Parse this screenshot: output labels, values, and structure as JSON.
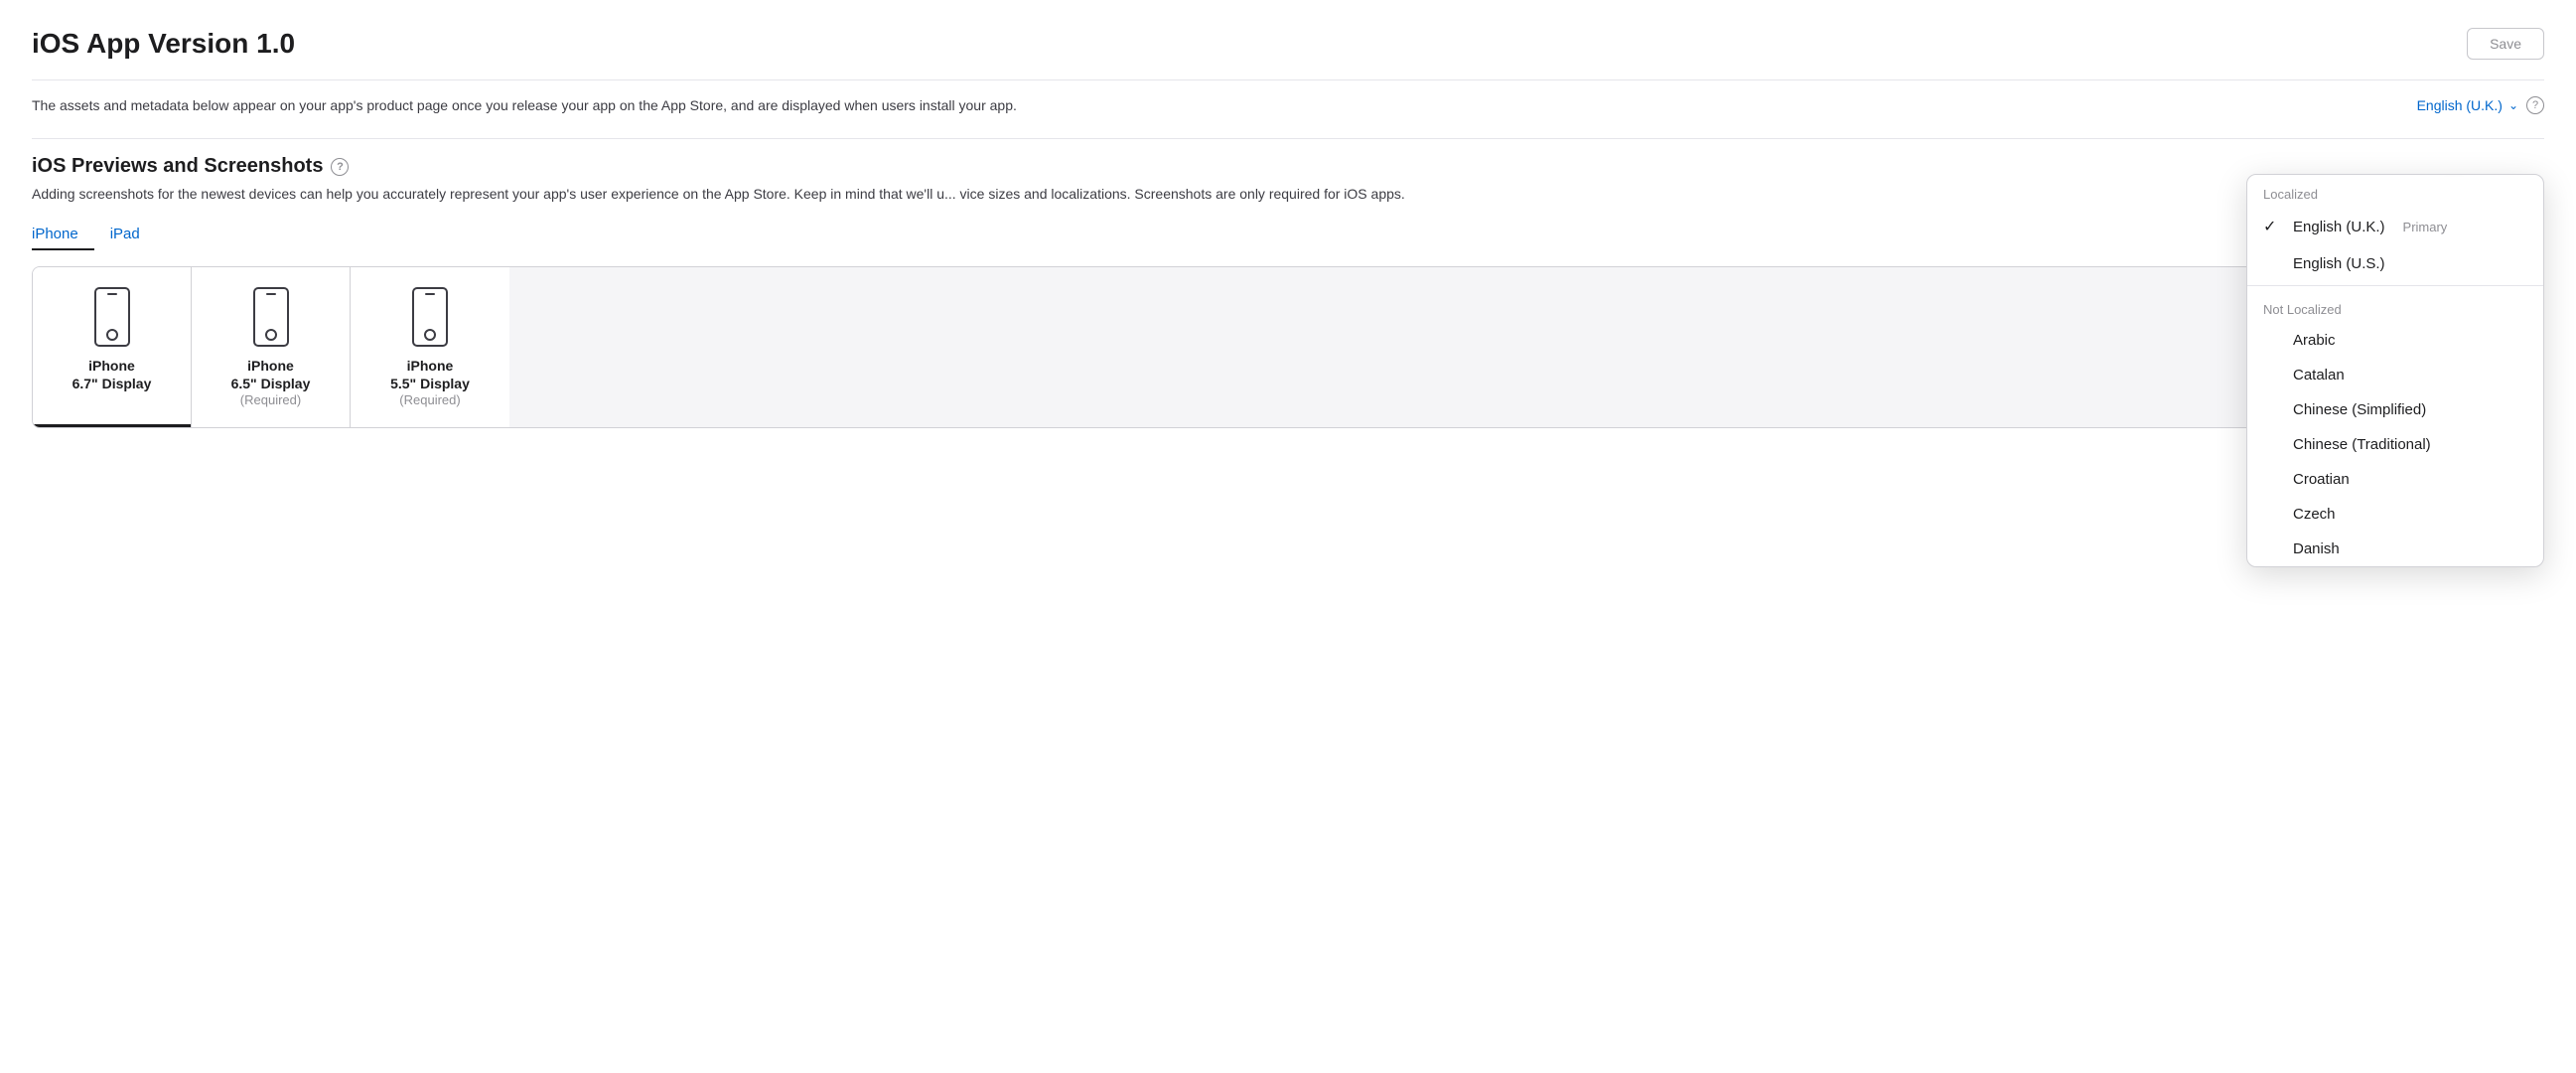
{
  "header": {
    "title": "iOS App Version 1.0",
    "save_button": "Save"
  },
  "description": {
    "text": "The assets and metadata below appear on your app's product page once you release your app on the App Store, and are displayed when users install your app.",
    "language_label": "English (U.K.)",
    "help_icon": "?"
  },
  "previews_section": {
    "title": "iOS Previews and Screenshots",
    "help_icon": "?",
    "description": "Adding screenshots for the newest devices can help you accurately represent your app's user experience on the App Store. Keep in mind that we'll u... vice sizes and localizations. Screenshots are only required for iOS apps."
  },
  "tabs": [
    {
      "label": "iPhone",
      "active": true
    },
    {
      "label": "iPad",
      "active": false
    }
  ],
  "device_panels": [
    {
      "name": "iPhone",
      "display": "6.7\" Display",
      "subtitle": "",
      "selected": true
    },
    {
      "name": "iPhone",
      "display": "6.5\" Display",
      "subtitle": "(Required)",
      "selected": false
    },
    {
      "name": "iPhone",
      "display": "5.5\" Display",
      "subtitle": "(Required)",
      "selected": false
    }
  ],
  "dropdown": {
    "localized_label": "Localized",
    "not_localized_label": "Not Localized",
    "localized_items": [
      {
        "label": "English (U.K.)",
        "checked": true,
        "primary": "Primary"
      },
      {
        "label": "English (U.S.)",
        "checked": false,
        "primary": ""
      }
    ],
    "not_localized_items": [
      "Arabic",
      "Catalan",
      "Chinese (Simplified)",
      "Chinese (Traditional)",
      "Croatian",
      "Czech",
      "Danish"
    ]
  }
}
